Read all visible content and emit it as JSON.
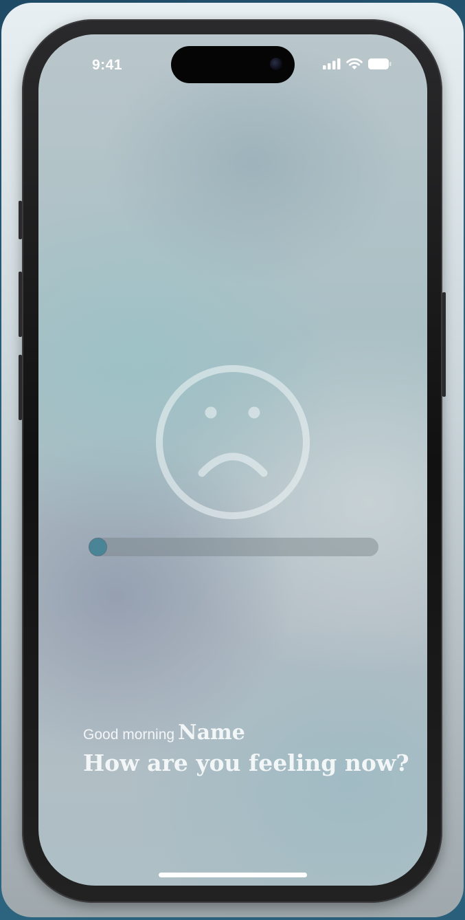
{
  "status_bar": {
    "time": "9:41",
    "icons": [
      "cellular-signal-icon",
      "wifi-icon",
      "battery-icon"
    ]
  },
  "mood": {
    "icon": "sad-face-icon",
    "slider_value": 0.0
  },
  "greeting": {
    "salutation": "Good morning",
    "name": "Name",
    "question": "How are you feeling now?"
  },
  "colors": {
    "slider_thumb": "#4a8497",
    "text": "#f3f6f7"
  }
}
